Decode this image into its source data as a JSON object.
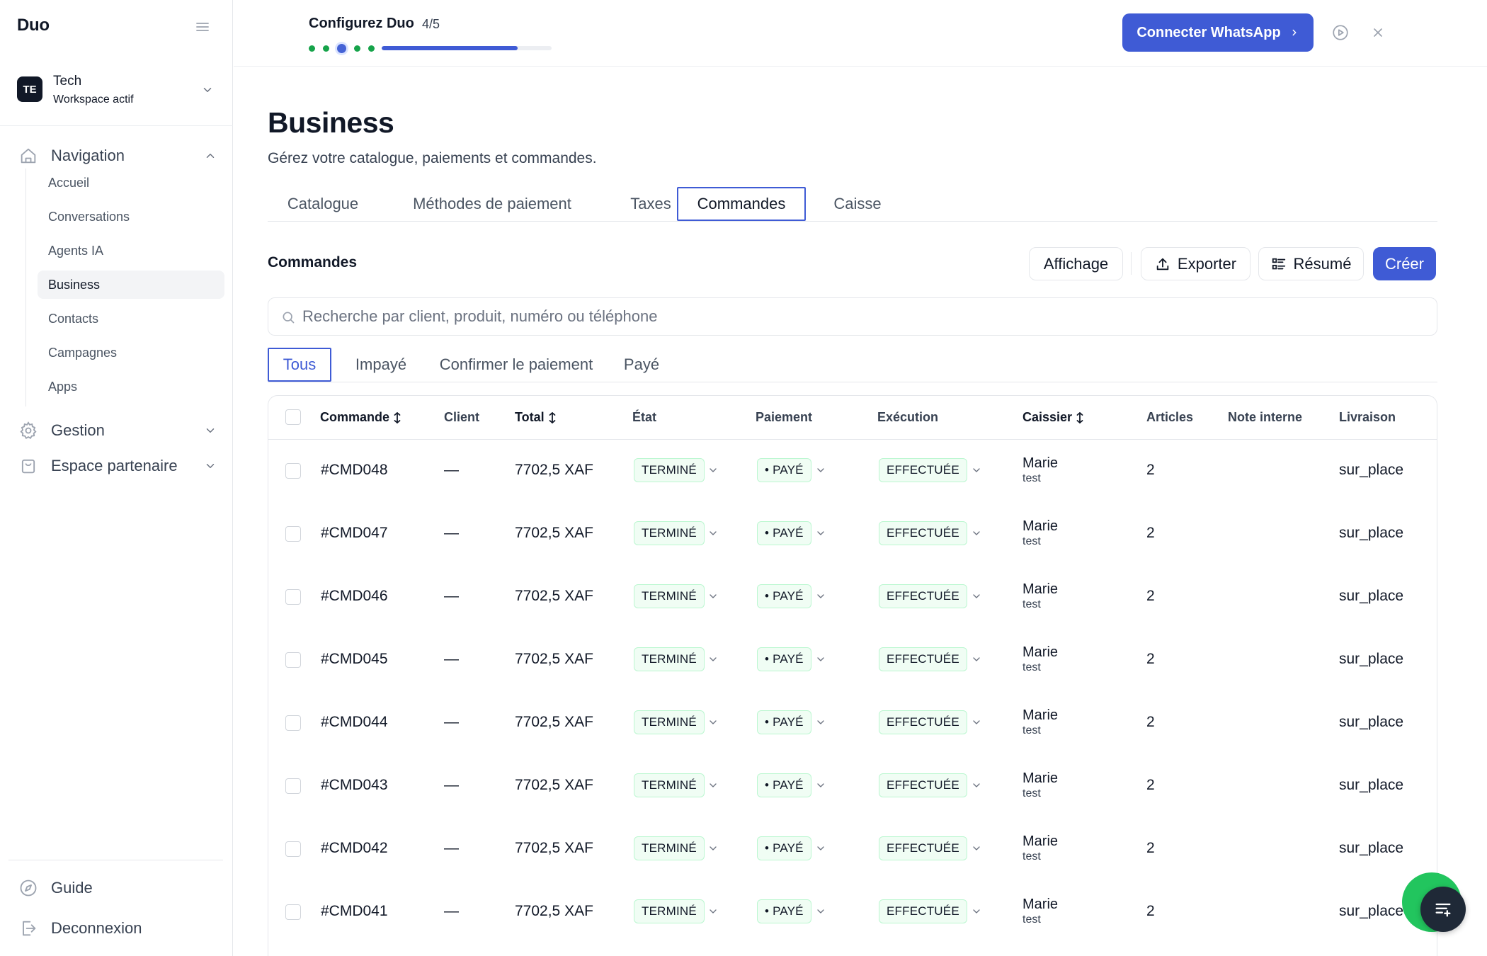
{
  "app": {
    "brand": "Duo"
  },
  "workspace": {
    "initials": "TE",
    "name": "Tech",
    "subtitle": "Workspace actif"
  },
  "sidebar": {
    "navigation_label": "Navigation",
    "items": [
      {
        "label": "Accueil"
      },
      {
        "label": "Conversations"
      },
      {
        "label": "Agents IA"
      },
      {
        "label": "Business"
      },
      {
        "label": "Contacts"
      },
      {
        "label": "Campagnes"
      },
      {
        "label": "Apps"
      }
    ],
    "active_item": "Business",
    "gestion_label": "Gestion",
    "partner_label": "Espace partenaire",
    "guide_label": "Guide",
    "logout_label": "Deconnexion"
  },
  "setup": {
    "title": "Configurez Duo",
    "step": "4/5",
    "progress": 0.8,
    "whatsapp_button": "Connecter WhatsApp"
  },
  "page": {
    "title": "Business",
    "subtitle": "Gérez votre catalogue, paiements et commandes."
  },
  "tabs": [
    "Catalogue",
    "Méthodes de paiement",
    "Taxes",
    "Commandes",
    "Caisse"
  ],
  "active_tab": "Commandes",
  "orders": {
    "section_title": "Commandes",
    "buttons": {
      "display": "Affichage",
      "export": "Exporter",
      "summary": "Résumé",
      "create": "Créer"
    },
    "search_placeholder": "Recherche par client, produit, numéro ou téléphone",
    "search_value": "",
    "filters": [
      "Tous",
      "Impayé",
      "Confirmer le paiement",
      "Payé"
    ],
    "active_filter": "Tous",
    "columns": [
      "Commande",
      "Client",
      "Total",
      "État",
      "Paiement",
      "Exécution",
      "Caissier",
      "Articles",
      "Note interne",
      "Livraison"
    ],
    "rows": [
      {
        "order": "#CMD048",
        "client": "—",
        "total": "7702,5 XAF",
        "state": "TERMINÉ",
        "payment": "• PAYÉ",
        "execution": "EFFECTUÉE",
        "cashier_name": "Marie",
        "cashier_sub": "test",
        "articles": "2",
        "note": "",
        "delivery": "sur_place"
      },
      {
        "order": "#CMD047",
        "client": "—",
        "total": "7702,5 XAF",
        "state": "TERMINÉ",
        "payment": "• PAYÉ",
        "execution": "EFFECTUÉE",
        "cashier_name": "Marie",
        "cashier_sub": "test",
        "articles": "2",
        "note": "",
        "delivery": "sur_place"
      },
      {
        "order": "#CMD046",
        "client": "—",
        "total": "7702,5 XAF",
        "state": "TERMINÉ",
        "payment": "• PAYÉ",
        "execution": "EFFECTUÉE",
        "cashier_name": "Marie",
        "cashier_sub": "test",
        "articles": "2",
        "note": "",
        "delivery": "sur_place"
      },
      {
        "order": "#CMD045",
        "client": "—",
        "total": "7702,5 XAF",
        "state": "TERMINÉ",
        "payment": "• PAYÉ",
        "execution": "EFFECTUÉE",
        "cashier_name": "Marie",
        "cashier_sub": "test",
        "articles": "2",
        "note": "",
        "delivery": "sur_place"
      },
      {
        "order": "#CMD044",
        "client": "—",
        "total": "7702,5 XAF",
        "state": "TERMINÉ",
        "payment": "• PAYÉ",
        "execution": "EFFECTUÉE",
        "cashier_name": "Marie",
        "cashier_sub": "test",
        "articles": "2",
        "note": "",
        "delivery": "sur_place"
      },
      {
        "order": "#CMD043",
        "client": "—",
        "total": "7702,5 XAF",
        "state": "TERMINÉ",
        "payment": "• PAYÉ",
        "execution": "EFFECTUÉE",
        "cashier_name": "Marie",
        "cashier_sub": "test",
        "articles": "2",
        "note": "",
        "delivery": "sur_place"
      },
      {
        "order": "#CMD042",
        "client": "—",
        "total": "7702,5 XAF",
        "state": "TERMINÉ",
        "payment": "• PAYÉ",
        "execution": "EFFECTUÉE",
        "cashier_name": "Marie",
        "cashier_sub": "test",
        "articles": "2",
        "note": "",
        "delivery": "sur_place"
      },
      {
        "order": "#CMD041",
        "client": "—",
        "total": "7702,5 XAF",
        "state": "TERMINÉ",
        "payment": "• PAYÉ",
        "execution": "EFFECTUÉE",
        "cashier_name": "Marie",
        "cashier_sub": "test",
        "articles": "2",
        "note": "",
        "delivery": "sur_place"
      }
    ]
  },
  "colors": {
    "accent": "#3f5bd5",
    "success": "#16a34a",
    "badge_bg": "#f0fdf4",
    "badge_border": "#bbf7d0",
    "fab_green": "#22c55e",
    "fab_dark": "#1f2937"
  },
  "icons": {
    "menu": "menu-icon",
    "workspace_chevron": "chevron-down-icon",
    "navigation": "home-icon",
    "gestion": "gear-icon",
    "partner": "shopping-bag-icon",
    "guide": "compass-icon",
    "logout": "logout-icon",
    "play": "play-circle-icon",
    "close": "close-icon",
    "search": "search-icon",
    "export": "upload-icon",
    "summary": "list-icon",
    "sort": "sort-icon",
    "chat": "chat-icon"
  }
}
